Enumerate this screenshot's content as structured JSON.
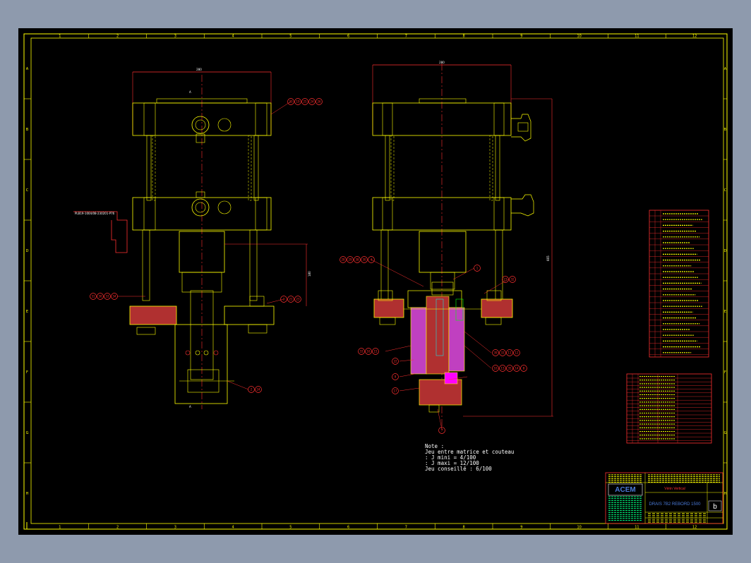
{
  "drawing": {
    "columns": [
      "1",
      "2",
      "3",
      "4",
      "5",
      "6",
      "7",
      "8",
      "9",
      "10",
      "11",
      "12"
    ],
    "rows": [
      "A",
      "B",
      "C",
      "D",
      "E",
      "F",
      "G",
      "H"
    ],
    "dimensions": {
      "left_width": "280",
      "right_width": "280",
      "left_height": "180",
      "right_height": "665"
    },
    "view_labels": {
      "top_a": "A",
      "bottom_a": "A"
    },
    "callout_left": "PLB19-1004/08-230201-P76",
    "note": {
      "title": "Note :",
      "line1": "Jeu entre matrice et couteau",
      "line2": ": J mini = 4/100",
      "line3": ": J maxi = 12/100",
      "line4": "Jeu conseillé : 6/100"
    },
    "bubbles": [
      "20",
      "19",
      "25",
      "24",
      "26",
      "31",
      "30",
      "33",
      "34",
      "3",
      "21",
      "23",
      "2",
      "24",
      "28",
      "29",
      "38",
      "30",
      "4",
      "1",
      "27",
      "32",
      "33",
      "16",
      "15",
      "39",
      "33",
      "11",
      "12",
      "10",
      "13",
      "35",
      "14",
      "8",
      "22",
      "9",
      "17",
      "7"
    ],
    "title_block": {
      "company": "ACEM",
      "title": "Vérin Vertical",
      "reference": "DRAIS 7B2 REBORD 1500",
      "revision": "b"
    }
  }
}
